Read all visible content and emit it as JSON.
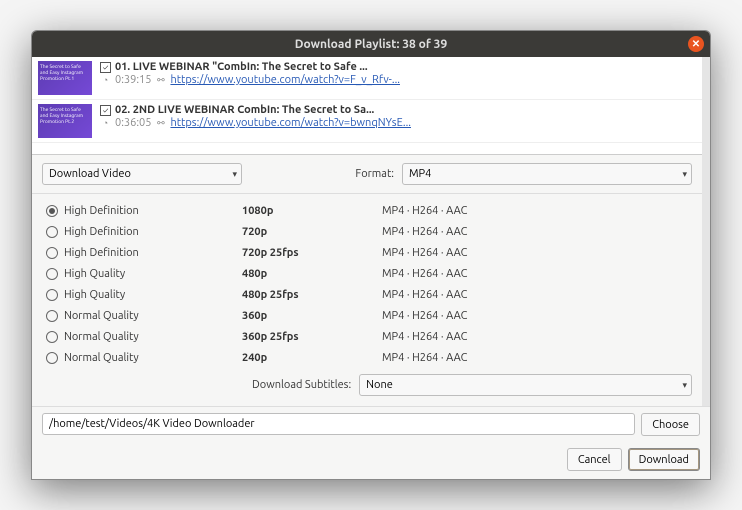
{
  "window": {
    "title": "Download Playlist: 38 of 39"
  },
  "playlist": [
    {
      "checked": true,
      "thumbText": "The Secret to Safe and Easy Instagram Promotion Pt.1",
      "title": "01. LIVE WEBINAR \"CombIn: The Secret to Safe ...",
      "duration": "0:39:15",
      "url": "https://www.youtube.com/watch?v=F_v_Rfv-..."
    },
    {
      "checked": true,
      "thumbText": "The Secret to Safe and Easy Instagram Promotion Pt.2",
      "title": "02. 2ND LIVE WEBINAR CombIn: The Secret to Sa...",
      "duration": "0:36:05",
      "url": "https://www.youtube.com/watch?v=bwnqNYsE..."
    }
  ],
  "actionCombo": "Download Video",
  "formatLabel": "Format:",
  "formatValue": "MP4",
  "qualities": [
    {
      "selected": true,
      "label": "High Definition",
      "res": "1080p",
      "codec": "MP4 · H264 · AAC"
    },
    {
      "selected": false,
      "label": "High Definition",
      "res": "720p",
      "codec": "MP4 · H264 · AAC"
    },
    {
      "selected": false,
      "label": "High Definition",
      "res": "720p 25fps",
      "codec": "MP4 · H264 · AAC"
    },
    {
      "selected": false,
      "label": "High Quality",
      "res": "480p",
      "codec": "MP4 · H264 · AAC"
    },
    {
      "selected": false,
      "label": "High Quality",
      "res": "480p 25fps",
      "codec": "MP4 · H264 · AAC"
    },
    {
      "selected": false,
      "label": "Normal Quality",
      "res": "360p",
      "codec": "MP4 · H264 · AAC"
    },
    {
      "selected": false,
      "label": "Normal Quality",
      "res": "360p 25fps",
      "codec": "MP4 · H264 · AAC"
    },
    {
      "selected": false,
      "label": "Normal Quality",
      "res": "240p",
      "codec": "MP4 · H264 · AAC"
    }
  ],
  "subsLabel": "Download Subtitles:",
  "subsValue": "None",
  "path": "/home/test/Videos/4K Video Downloader",
  "buttons": {
    "choose": "Choose",
    "cancel": "Cancel",
    "download": "Download"
  }
}
